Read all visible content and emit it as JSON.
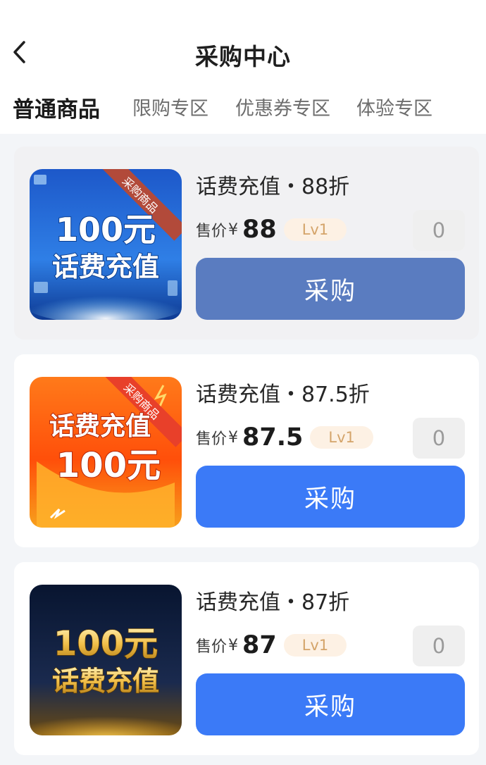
{
  "header": {
    "title": "采购中心",
    "back_icon": "chevron-left-icon"
  },
  "tabs": [
    {
      "label": "普通商品",
      "active": true
    },
    {
      "label": "限购专区",
      "active": false
    },
    {
      "label": "优惠券专区",
      "active": false
    },
    {
      "label": "体验专区",
      "active": false
    }
  ],
  "products": [
    {
      "name": "话费充值・88折",
      "price_label": "售价",
      "currency": "¥",
      "price": "88",
      "level": "Lv1",
      "quantity": "0",
      "buy_label": "采购",
      "image": {
        "ribbon": "采购商品",
        "line1": "100元",
        "line2": "话费充值",
        "theme": "blue"
      }
    },
    {
      "name": "话费充值・87.5折",
      "price_label": "售价",
      "currency": "¥",
      "price": "87.5",
      "level": "Lv1",
      "quantity": "0",
      "buy_label": "采购",
      "image": {
        "ribbon": "采购商品",
        "line1": "话费充值",
        "line2": "100元",
        "theme": "orange"
      }
    },
    {
      "name": "话费充值・87折",
      "price_label": "售价",
      "currency": "¥",
      "price": "87",
      "level": "Lv1",
      "quantity": "0",
      "buy_label": "采购",
      "image": {
        "line1": "100元",
        "line2": "话费充值",
        "theme": "gold"
      }
    }
  ],
  "colors": {
    "accent": "#3b7af7",
    "pressed_button": "#5a7cc0",
    "level_badge_bg": "#fdf1e4",
    "level_badge_text": "#d4a46a"
  }
}
